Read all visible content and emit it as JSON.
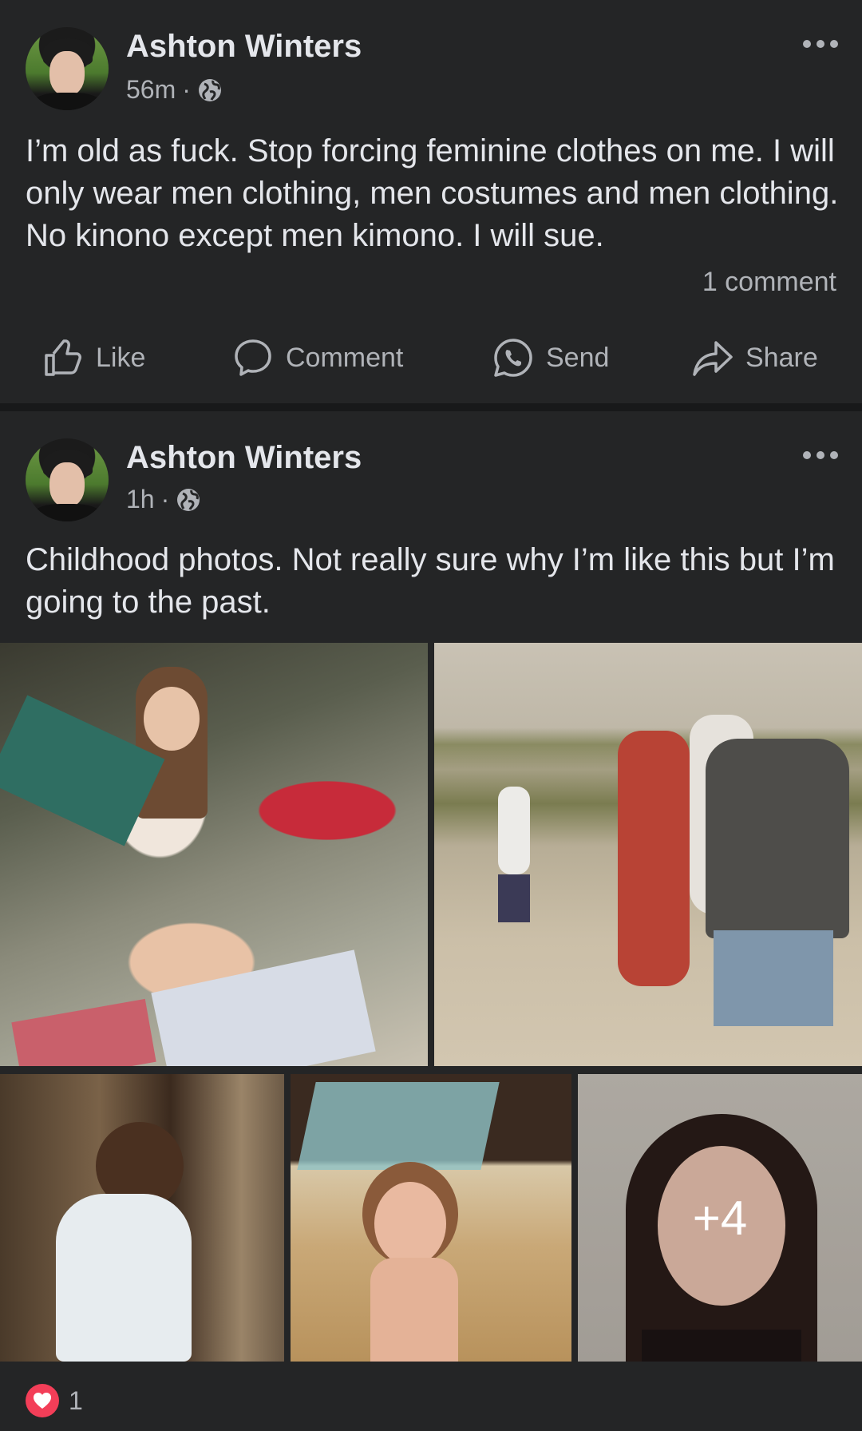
{
  "posts": [
    {
      "author": "Ashton Winters",
      "time": "56m",
      "separator": "·",
      "privacy_icon": "globe-icon",
      "text": "I’m old as fuck.  Stop forcing feminine clothes on me.  I will only wear men clothing, men costumes and men clothing.  No kinono except men kimono.  I will sue.",
      "comment_count": "1 comment",
      "actions": {
        "like": "Like",
        "comment": "Comment",
        "send": "Send",
        "share": "Share"
      }
    },
    {
      "author": "Ashton Winters",
      "time": "1h",
      "separator": "·",
      "privacy_icon": "globe-icon",
      "text": "Childhood photos.  Not really sure why I’m like this but I’m going to the past.",
      "photos": [
        {
          "description": "child opening christmas presents"
        },
        {
          "description": "people at marsh shore"
        },
        {
          "description": "toddler in white dress outdoors"
        },
        {
          "description": "toddler near dishwasher"
        },
        {
          "description": "school portrait"
        }
      ],
      "more_photos": "+4",
      "reaction_count": "1",
      "reaction_icon": "heart-icon"
    }
  ],
  "colors": {
    "background": "#18191a",
    "card": "#242526",
    "text_primary": "#e4e6eb",
    "text_secondary": "#b0b3b8",
    "love_reaction": "#f33e58"
  }
}
